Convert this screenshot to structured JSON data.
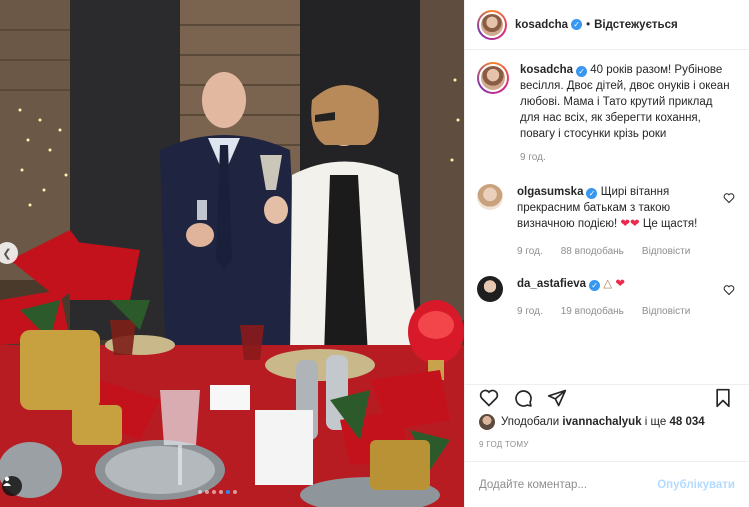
{
  "post": {
    "username": "kosadcha",
    "bullet": "•",
    "follow_state": "Відстежується"
  },
  "caption": {
    "username": "kosadcha",
    "text": "40 років разом! Рубінове весілля. Двоє дітей, двоє онуків і океан любові. Мама і Тато крутий приклад для нас всіх, як зберегти кохання, повагу і стосунки крізь роки",
    "time": "9 год."
  },
  "comments": [
    {
      "username": "olgasumska",
      "text": "Щирі вітання прекрасним батькам з такою визначною подією!",
      "text_tail": "Це щастя!",
      "time": "9 год.",
      "likes": "88 вподобань",
      "reply": "Відповісти"
    },
    {
      "username": "da_astafieva",
      "time": "9 год.",
      "likes": "19 вподобань",
      "reply": "Відповісти"
    }
  ],
  "likes_line": {
    "prefix": "Уподобали",
    "user": "ivannachalyuk",
    "middle": "і ще",
    "count": "48 034"
  },
  "time_ago": "9 ГОД ТОМУ",
  "comment_box": {
    "placeholder": "Додайте коментар...",
    "publish": "Опублікувати"
  },
  "carousel": {
    "slides": 6,
    "active_index": 4
  },
  "colors": {
    "accent": "#3897f0",
    "publish_disabled": "#b3dbff",
    "heart": "#ed2b4d",
    "muted": "#8e8e8e"
  },
  "icons": [
    "heart-icon",
    "comment-icon",
    "share-icon",
    "bookmark-icon",
    "verified-icon",
    "tag-user-icon",
    "chevron-left-icon"
  ]
}
